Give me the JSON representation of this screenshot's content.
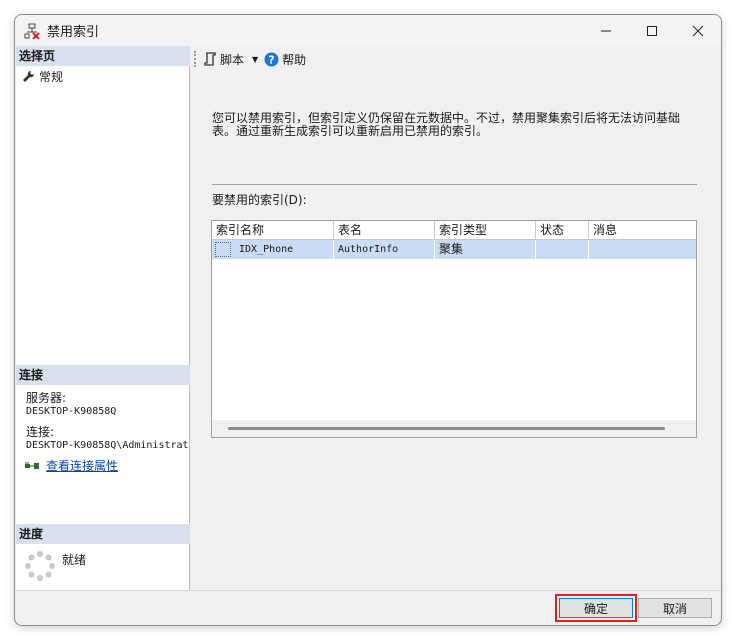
{
  "window": {
    "title": "禁用索引"
  },
  "left": {
    "pages_header": "选择页",
    "pages": [
      {
        "label": "常规",
        "icon": "wrench-icon"
      }
    ],
    "connection_header": "连接",
    "server_label": "服务器:",
    "server_value": "DESKTOP-K90858Q",
    "connection_label": "连接:",
    "connection_value": "DESKTOP-K90858Q\\Administrat",
    "view_conn_link": "查看连接属性",
    "progress_header": "进度",
    "progress_status": "就绪"
  },
  "toolbar": {
    "script_label": "脚本",
    "help_label": "帮助"
  },
  "main": {
    "description": "您可以禁用索引，但索引定义仍保留在元数据中。不过，禁用聚集索引后将无法访问基础表。通过重新生成索引可以重新启用已禁用的索引。",
    "grid_label": "要禁用的索引(D):",
    "columns": [
      "索引名称",
      "表名",
      "索引类型",
      "状态",
      "消息"
    ],
    "rows": [
      {
        "index_name": "IDX_Phone",
        "table_name": "AuthorInfo",
        "index_type": "聚集",
        "status": "",
        "message": ""
      }
    ]
  },
  "buttons": {
    "ok_label": "确定",
    "cancel_label": "取消"
  },
  "colors": {
    "section_header": "#d7e0ec",
    "row_selected": "#c9dcf3",
    "highlight_outline": "#e02020",
    "link": "#0645ad"
  }
}
